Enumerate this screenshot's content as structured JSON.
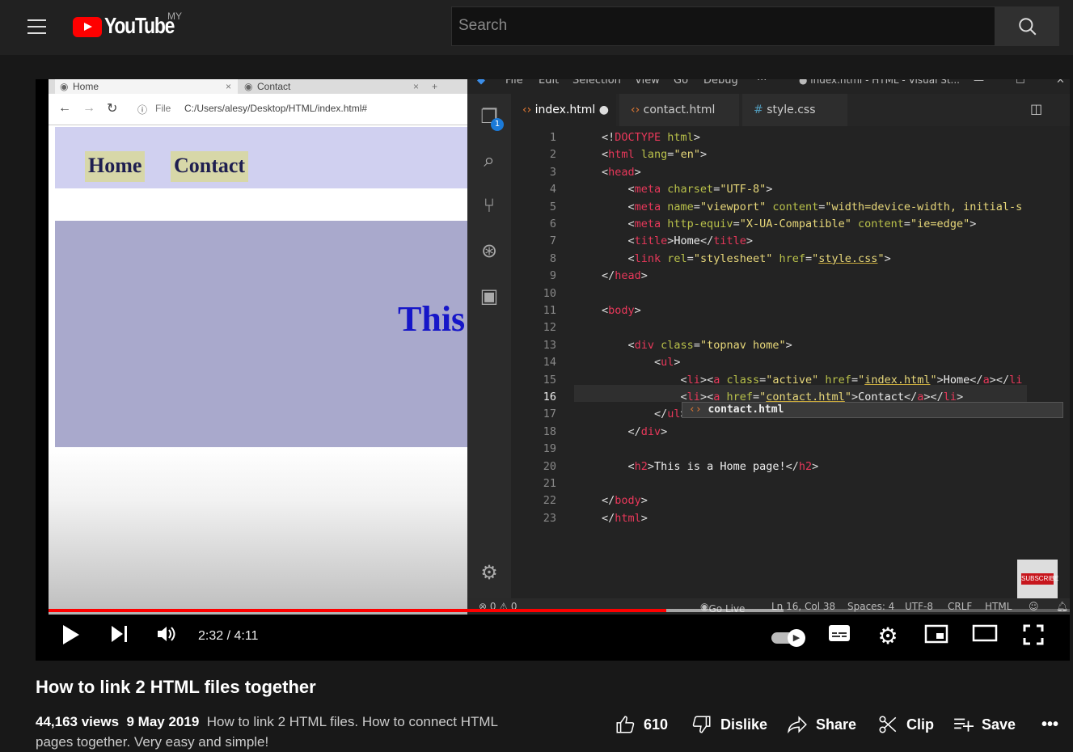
{
  "header": {
    "logo_text": "YouTube",
    "region": "MY",
    "search_placeholder": "Search"
  },
  "browser": {
    "tabs": [
      "Home",
      "Contact"
    ],
    "address_scheme": "File",
    "address": "C:/Users/alesy/Desktop/HTML/index.html#",
    "nav": [
      "Home",
      "Contact"
    ],
    "hero_text": "This"
  },
  "vscode": {
    "menu": [
      "File",
      "Edit",
      "Selection",
      "View",
      "Go",
      "Debug",
      "···",
      "● index.html - HTML - Visual St..."
    ],
    "tabs": [
      {
        "label": "index.html",
        "modified": true
      },
      {
        "label": "contact.html"
      },
      {
        "label": "style.css"
      }
    ],
    "explorer_badge": "1",
    "code": [
      [
        [
          "p",
          "<!"
        ],
        [
          "t",
          "DOCTYPE"
        ],
        [
          "a",
          " html"
        ],
        [
          "p",
          ">"
        ]
      ],
      [
        [
          "p",
          "<"
        ],
        [
          "t",
          "html"
        ],
        [
          "a",
          " lang"
        ],
        [
          "p",
          "="
        ],
        [
          "s",
          "\"en\""
        ],
        [
          "p",
          ">"
        ]
      ],
      [
        [
          "p",
          "<"
        ],
        [
          "t",
          "head"
        ],
        [
          "p",
          ">"
        ]
      ],
      [
        [
          "p",
          "    <"
        ],
        [
          "t",
          "meta"
        ],
        [
          "a",
          " charset"
        ],
        [
          "p",
          "="
        ],
        [
          "s",
          "\"UTF-8\""
        ],
        [
          "p",
          ">"
        ]
      ],
      [
        [
          "p",
          "    <"
        ],
        [
          "t",
          "meta"
        ],
        [
          "a",
          " name"
        ],
        [
          "p",
          "="
        ],
        [
          "s",
          "\"viewport\""
        ],
        [
          "a",
          " content"
        ],
        [
          "p",
          "="
        ],
        [
          "s",
          "\"width=device-width, initial-s"
        ]
      ],
      [
        [
          "p",
          "    <"
        ],
        [
          "t",
          "meta"
        ],
        [
          "a",
          " http-equiv"
        ],
        [
          "p",
          "="
        ],
        [
          "s",
          "\"X-UA-Compatible\""
        ],
        [
          "a",
          " content"
        ],
        [
          "p",
          "="
        ],
        [
          "s",
          "\"ie=edge\""
        ],
        [
          "p",
          ">"
        ]
      ],
      [
        [
          "p",
          "    <"
        ],
        [
          "t",
          "title"
        ],
        [
          "p",
          ">"
        ],
        [
          "x",
          "Home"
        ],
        [
          "p",
          "</"
        ],
        [
          "t",
          "title"
        ],
        [
          "p",
          ">"
        ]
      ],
      [
        [
          "p",
          "    <"
        ],
        [
          "t",
          "link"
        ],
        [
          "a",
          " rel"
        ],
        [
          "p",
          "="
        ],
        [
          "s",
          "\"stylesheet\""
        ],
        [
          "a",
          " href"
        ],
        [
          "p",
          "="
        ],
        [
          "s",
          "\""
        ],
        [
          "su",
          "style.css"
        ],
        [
          "s",
          "\""
        ],
        [
          "p",
          ">"
        ]
      ],
      [
        [
          "p",
          "</"
        ],
        [
          "t",
          "head"
        ],
        [
          "p",
          ">"
        ]
      ],
      [],
      [
        [
          "p",
          "<"
        ],
        [
          "t",
          "body"
        ],
        [
          "p",
          ">"
        ]
      ],
      [],
      [
        [
          "p",
          "    <"
        ],
        [
          "t",
          "div"
        ],
        [
          "a",
          " class"
        ],
        [
          "p",
          "="
        ],
        [
          "s",
          "\"topnav home\""
        ],
        [
          "p",
          ">"
        ]
      ],
      [
        [
          "p",
          "        <"
        ],
        [
          "t",
          "ul"
        ],
        [
          "p",
          ">"
        ]
      ],
      [
        [
          "p",
          "            <"
        ],
        [
          "t",
          "li"
        ],
        [
          "p",
          "><"
        ],
        [
          "t",
          "a"
        ],
        [
          "a",
          " class"
        ],
        [
          "p",
          "="
        ],
        [
          "s",
          "\"active\""
        ],
        [
          "a",
          " href"
        ],
        [
          "p",
          "="
        ],
        [
          "s",
          "\""
        ],
        [
          "su",
          "index.html"
        ],
        [
          "s",
          "\""
        ],
        [
          "p",
          ">"
        ],
        [
          "x",
          "Home"
        ],
        [
          "p",
          "</"
        ],
        [
          "t",
          "a"
        ],
        [
          "p",
          "></"
        ],
        [
          "t",
          "li"
        ]
      ],
      [
        [
          "p",
          "            <"
        ],
        [
          "t",
          "li"
        ],
        [
          "p",
          "><"
        ],
        [
          "t",
          "a"
        ],
        [
          "a",
          " href"
        ],
        [
          "p",
          "="
        ],
        [
          "s",
          "\""
        ],
        [
          "su",
          "contact.html"
        ],
        [
          "s",
          "\""
        ],
        [
          "p",
          ">"
        ],
        [
          "x",
          "Contact"
        ],
        [
          "p",
          "</"
        ],
        [
          "t",
          "a"
        ],
        [
          "p",
          "></"
        ],
        [
          "t",
          "li"
        ],
        [
          "p",
          ">"
        ]
      ],
      [
        [
          "p",
          "        </"
        ],
        [
          "t",
          "ul"
        ],
        [
          "p",
          ">"
        ]
      ],
      [
        [
          "p",
          "    </"
        ],
        [
          "t",
          "div"
        ],
        [
          "p",
          ">"
        ]
      ],
      [],
      [
        [
          "p",
          "    <"
        ],
        [
          "t",
          "h2"
        ],
        [
          "p",
          ">"
        ],
        [
          "x",
          "This is a Home page!"
        ],
        [
          "p",
          "</"
        ],
        [
          "t",
          "h2"
        ],
        [
          "p",
          ">"
        ]
      ],
      [],
      [
        [
          "p",
          "</"
        ],
        [
          "t",
          "body"
        ],
        [
          "p",
          ">"
        ]
      ],
      [
        [
          "p",
          "</"
        ],
        [
          "t",
          "html"
        ],
        [
          "p",
          ">"
        ]
      ]
    ],
    "suggestion": "contact.html",
    "status": {
      "problems": "⊗ 0 ⚠ 0",
      "go_live": "Go Live",
      "position": "Ln 16, Col 38",
      "spaces": "Spaces: 4",
      "encoding": "UTF-8",
      "eol": "CRLF",
      "language": "HTML"
    }
  },
  "subscribe_badge": "SUBSCRIBE",
  "player": {
    "current_time": "2:32",
    "duration": "4:11",
    "time_display": "2:32 / 4:11",
    "progress": 0.605,
    "buffered": 0.72,
    "autoplay": true
  },
  "video": {
    "title": "How to link 2 HTML files together",
    "views": "44,163 views",
    "date": "9 May 2019",
    "description": "How to link 2 HTML files. How to connect HTML pages together. Very easy and simple!",
    "likes": "610",
    "dislike_label": "Dislike",
    "share_label": "Share",
    "clip_label": "Clip",
    "save_label": "Save"
  },
  "colors": {
    "brand_red": "#ff0000",
    "background": "#181818",
    "header": "#212121"
  }
}
